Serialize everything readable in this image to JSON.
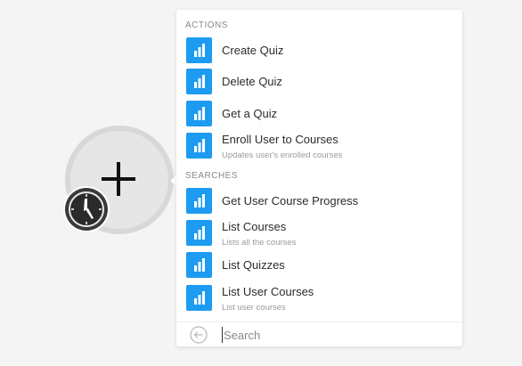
{
  "colors": {
    "app_icon": "#1d9bf0",
    "background": "#f4f4f4",
    "panel": "#ffffff"
  },
  "node": {
    "add_icon": "plus-icon",
    "trigger_icon": "clock-icon"
  },
  "dropdown": {
    "sections": [
      {
        "label": "ACTIONS",
        "items": [
          {
            "title": "Create Quiz",
            "subtitle": "",
            "icon": "bar-chart-icon"
          },
          {
            "title": "Delete Quiz",
            "subtitle": "",
            "icon": "bar-chart-icon"
          },
          {
            "title": "Get a Quiz",
            "subtitle": "",
            "icon": "bar-chart-icon"
          },
          {
            "title": "Enroll User to Courses",
            "subtitle": "Updates user's enrolled courses",
            "icon": "bar-chart-icon"
          }
        ]
      },
      {
        "label": "SEARCHES",
        "items": [
          {
            "title": "Get User Course Progress",
            "subtitle": "",
            "icon": "bar-chart-icon"
          },
          {
            "title": "List Courses",
            "subtitle": "Lists all the courses",
            "icon": "bar-chart-icon"
          },
          {
            "title": "List Quizzes",
            "subtitle": "",
            "icon": "bar-chart-icon"
          },
          {
            "title": "List User Courses",
            "subtitle": "List user courses",
            "icon": "bar-chart-icon"
          }
        ]
      }
    ],
    "search": {
      "placeholder": "Search",
      "value": "",
      "back_icon": "back-arrow-icon"
    }
  }
}
